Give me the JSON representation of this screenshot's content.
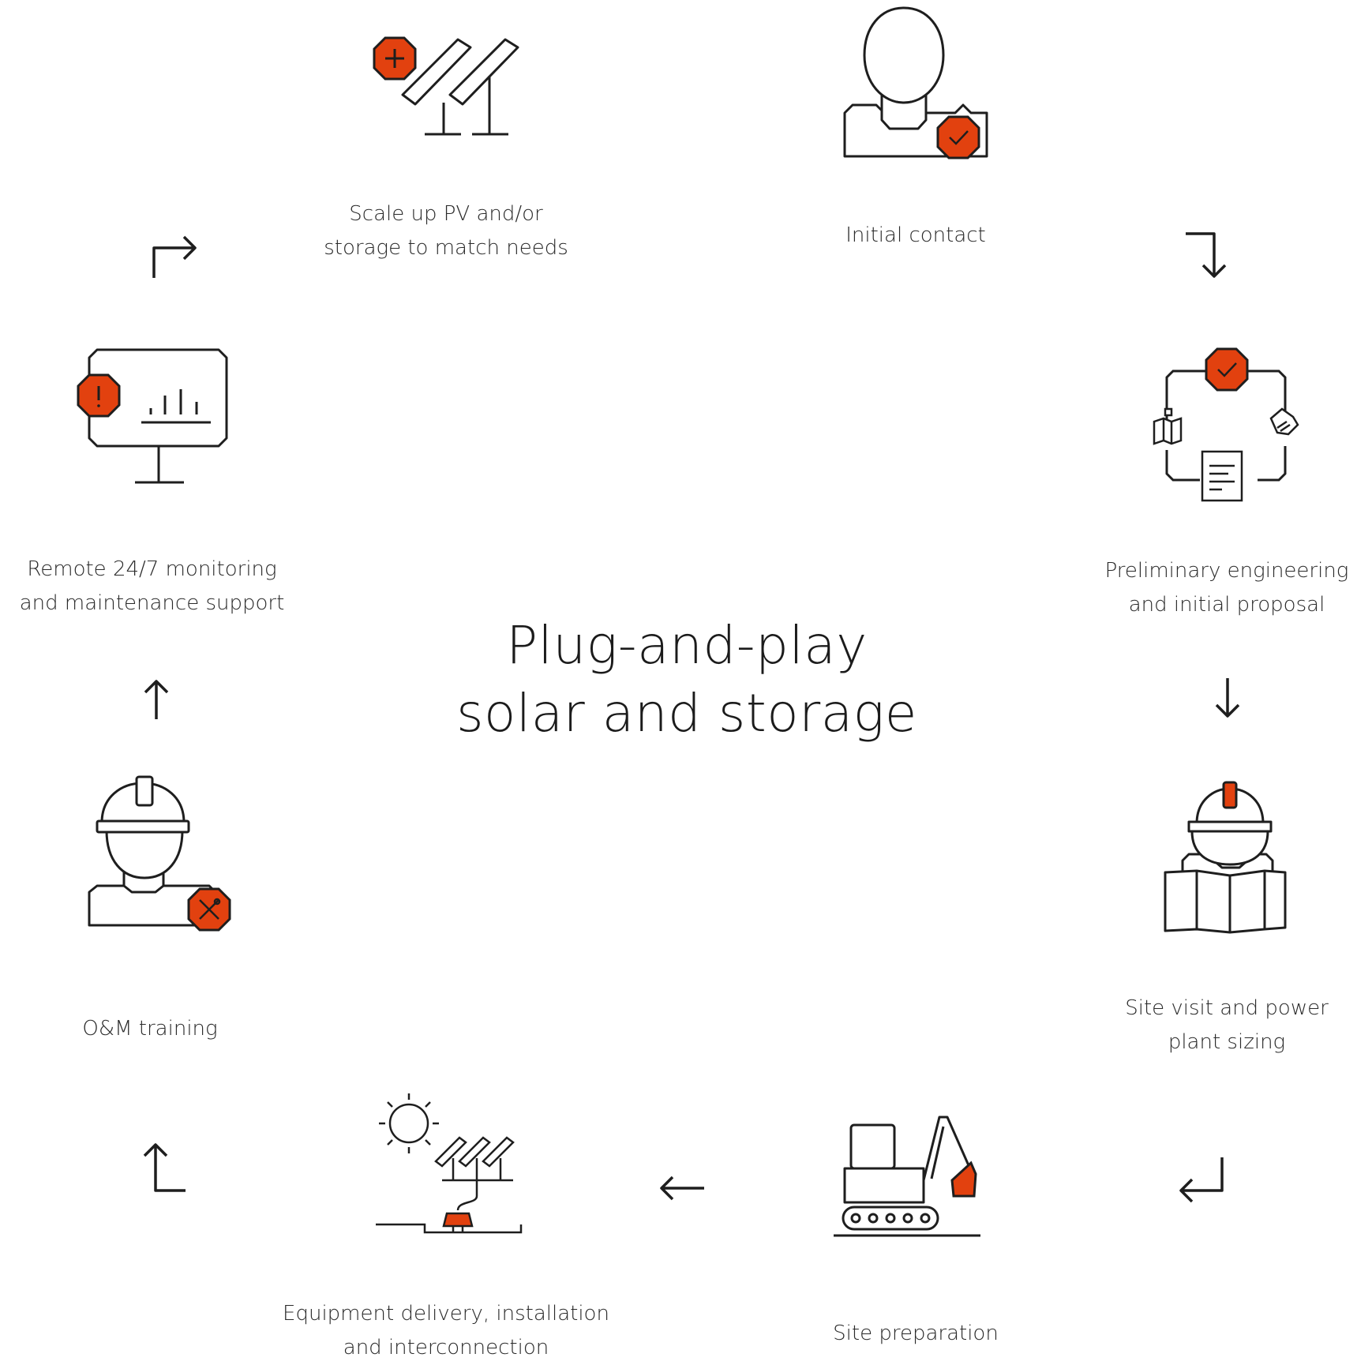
{
  "title": {
    "line1": "Plug-and-play",
    "line2": "solar and storage"
  },
  "colors": {
    "accent": "#e2410f",
    "stroke": "#1e1e1e",
    "background": "#ffffff"
  },
  "steps": [
    {
      "id": "initial-contact",
      "icon": "person-check-icon",
      "line1": "Initial contact",
      "line2": ""
    },
    {
      "id": "preliminary-engineering",
      "icon": "engineering-cycle-icon",
      "line1": "Preliminary engineering",
      "line2": "and initial proposal"
    },
    {
      "id": "site-visit",
      "icon": "engineer-map-icon",
      "line1": "Site visit and power",
      "line2": "plant sizing"
    },
    {
      "id": "site-preparation",
      "icon": "excavator-icon",
      "line1": "Site preparation",
      "line2": ""
    },
    {
      "id": "equipment-delivery",
      "icon": "solar-installation-icon",
      "line1": "Equipment delivery, installation",
      "line2": "and interconnection"
    },
    {
      "id": "om-training",
      "icon": "worker-tools-icon",
      "line1": "O&M training",
      "line2": ""
    },
    {
      "id": "remote-monitoring",
      "icon": "monitor-alert-icon",
      "line1": "Remote 24/7 monitoring",
      "line2": "and maintenance support"
    },
    {
      "id": "scale-up",
      "icon": "solar-panels-plus-icon",
      "line1": "Scale up PV and/or",
      "line2": "storage to match needs"
    }
  ]
}
